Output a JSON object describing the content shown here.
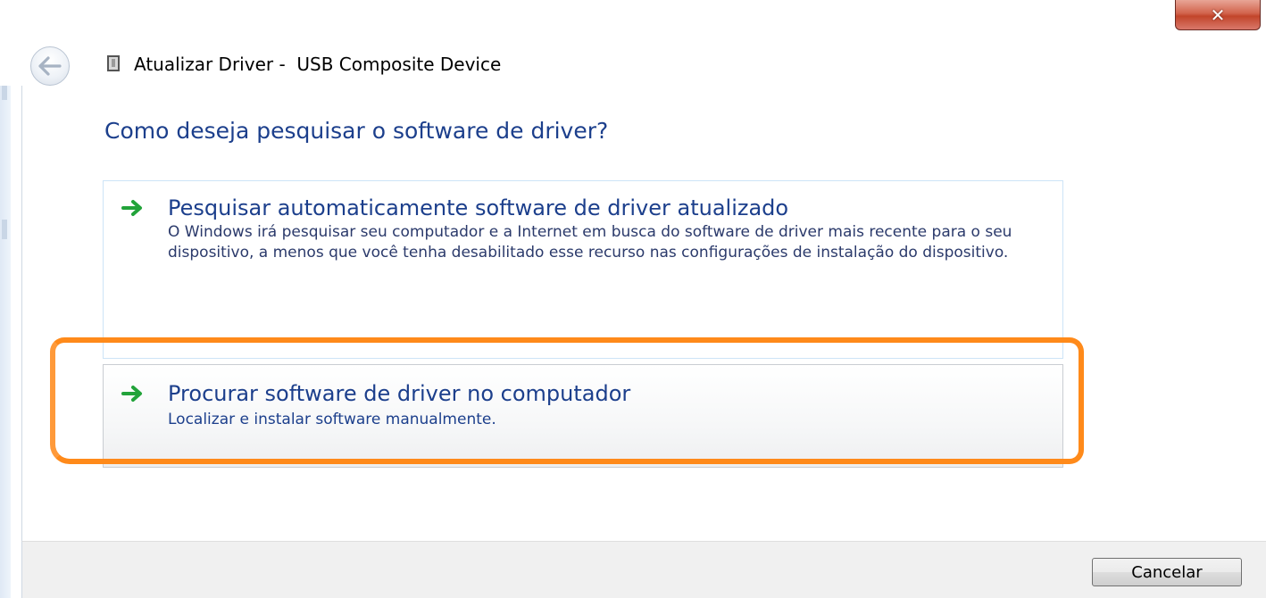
{
  "window": {
    "title": "Atualizar Driver -  USB Composite Device",
    "close_label": "✕"
  },
  "heading": "Como deseja pesquisar o software de driver?",
  "options": [
    {
      "title": "Pesquisar automaticamente software de driver atualizado",
      "description": "O Windows irá pesquisar seu computador e a Internet em busca do software de driver mais recente para o seu dispositivo, a menos que você tenha desabilitado esse recurso nas configurações de instalação do dispositivo.",
      "icon": "green-arrow-icon"
    },
    {
      "title": "Procurar software de driver no computador",
      "description": "Localizar e instalar software manualmente.",
      "icon": "green-arrow-icon",
      "highlighted": true
    }
  ],
  "footer": {
    "cancel_label": "Cancelar"
  },
  "colors": {
    "heading": "#1c3f8c",
    "highlight": "#ff8a1a",
    "arrow": "#22a33a",
    "close": "#c2452a"
  }
}
